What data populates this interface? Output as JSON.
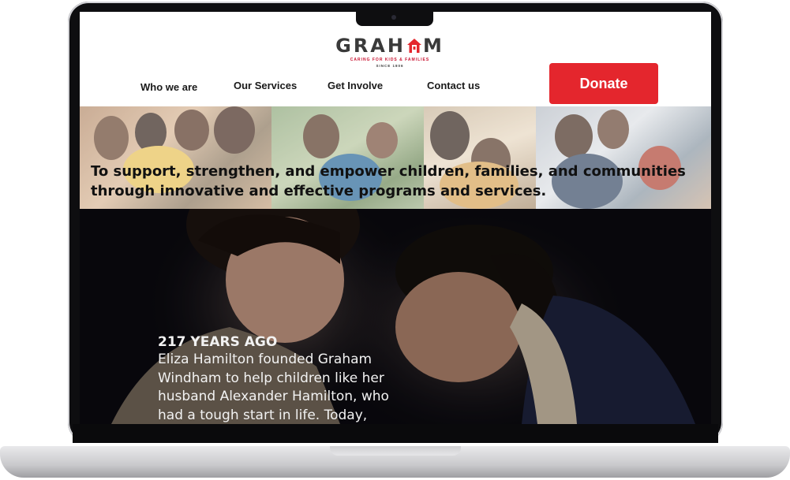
{
  "brand": {
    "logo_text_left": "GRAH",
    "logo_text_right": "M",
    "tagline": "CARING FOR KIDS & FAMILIES",
    "since": "SINCE 1806",
    "accent_color": "#e4262d"
  },
  "nav": {
    "items": [
      {
        "label": "Who we are"
      },
      {
        "label": "Our Services"
      },
      {
        "label": "Get Involve"
      },
      {
        "label": "Contact us"
      }
    ],
    "donate_label": "Donate"
  },
  "hero": {
    "mission_line1": "To support, strengthen, and empower children, families, and communities",
    "mission_line2": "through innovative and effective programs and services."
  },
  "feature": {
    "title": "217 YEARS AGO",
    "body": "Eliza Hamilton founded Graham Windham to help children like her husband Alexander Hamilton, who had a tough start in life. Today, Graham"
  }
}
